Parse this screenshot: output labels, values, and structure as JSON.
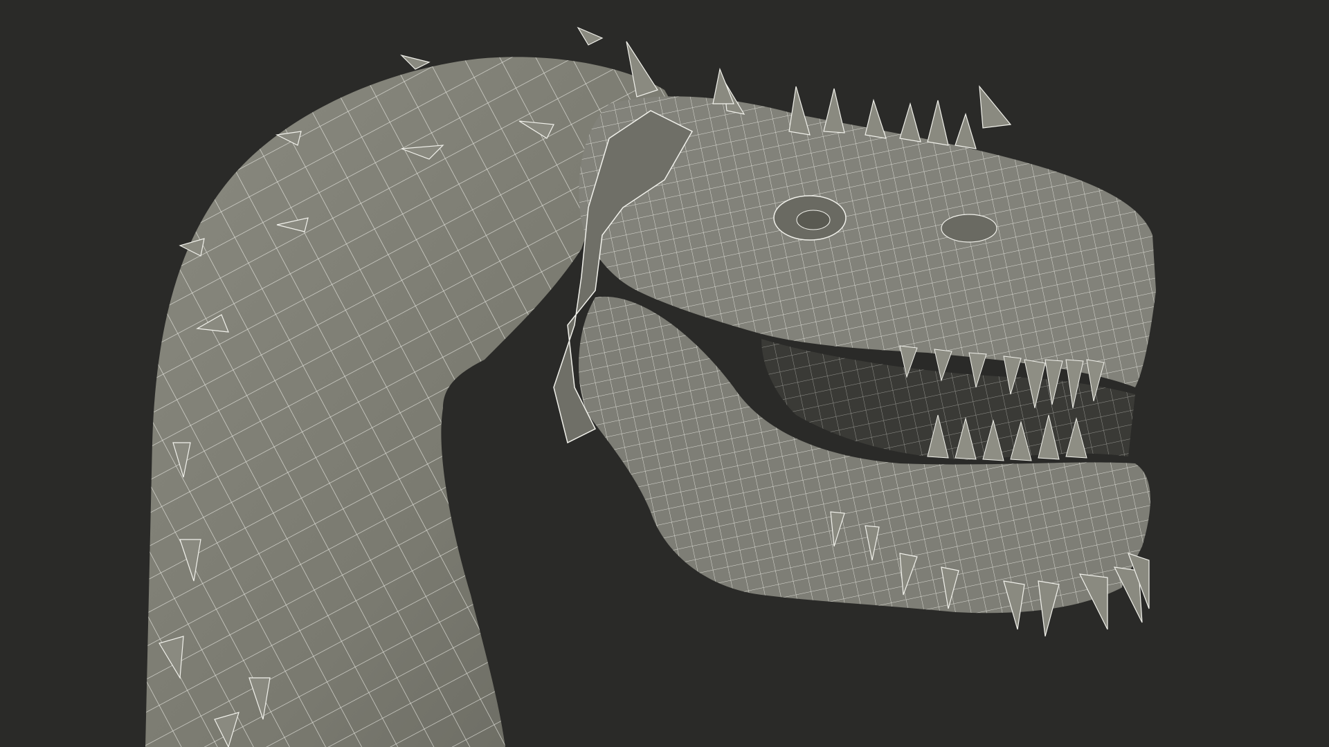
{
  "scene": {
    "background_color": "#2a2a28",
    "mesh_fill_color": "#7d7d73",
    "mesh_shadow_color": "#5f5f57",
    "mesh_highlight_color": "#92928a",
    "wire_color": "#f2f2ec",
    "spike_color": "#8a8a80"
  }
}
